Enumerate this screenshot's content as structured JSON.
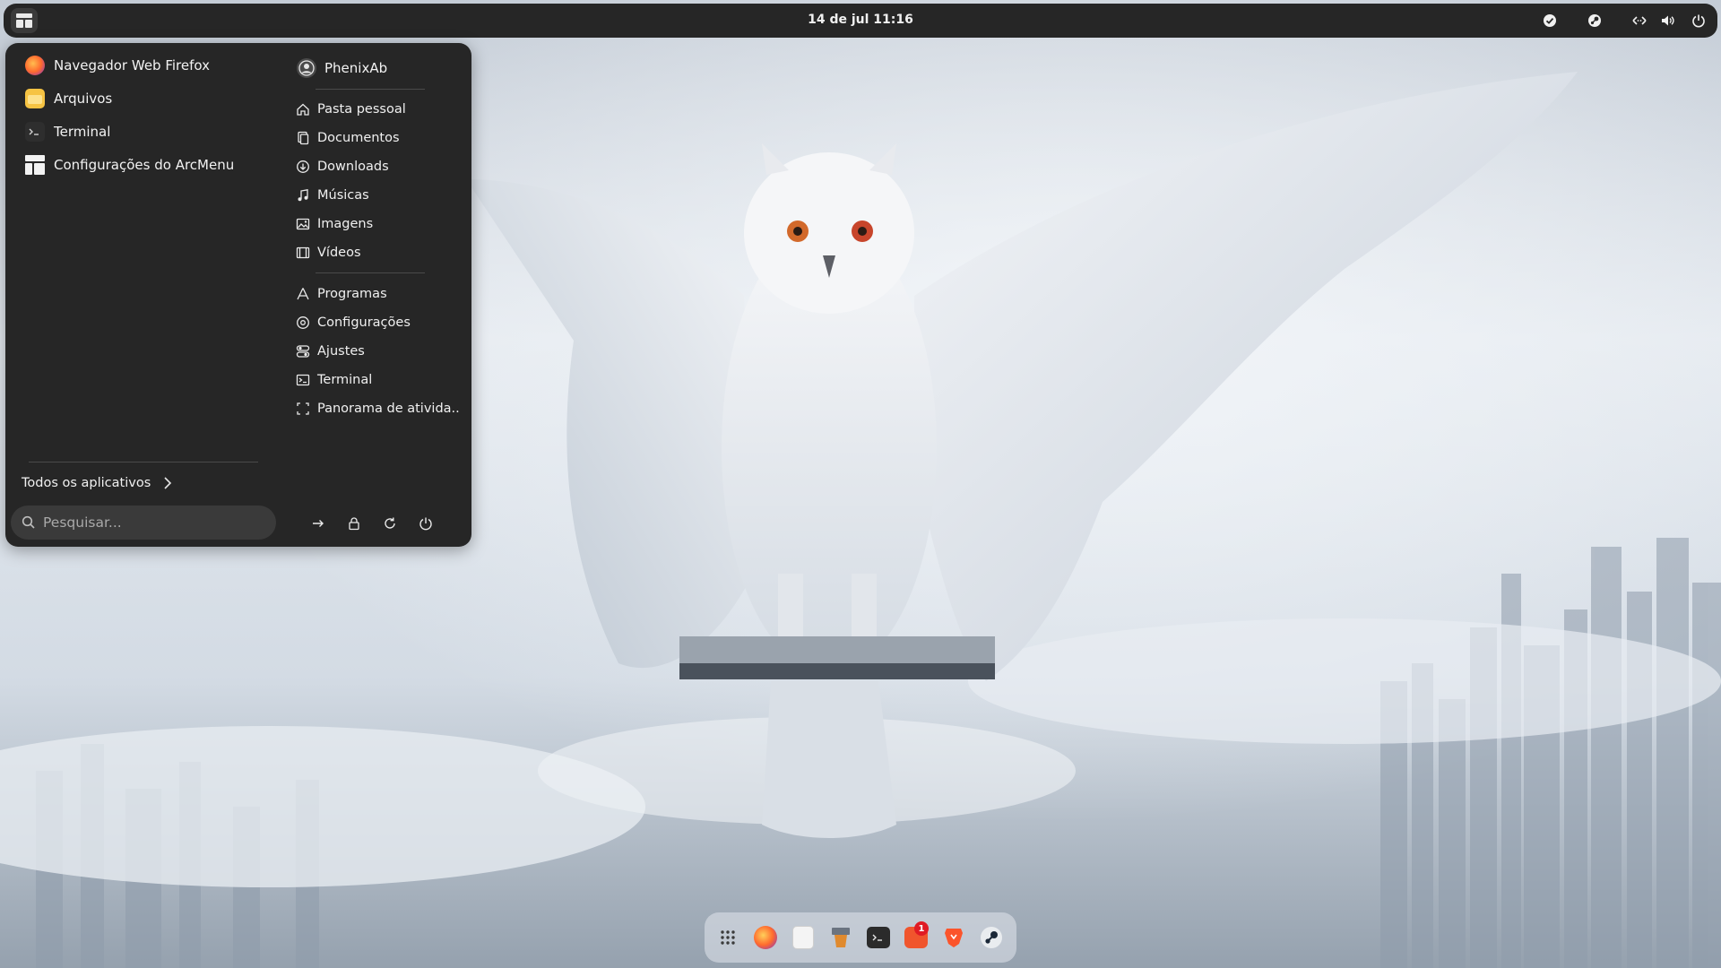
{
  "topbar": {
    "clock": "14 de jul  11:16"
  },
  "menu": {
    "favorites": [
      {
        "label": "Navegador Web Firefox",
        "icon": "firefox-icon"
      },
      {
        "label": "Arquivos",
        "icon": "files-icon"
      },
      {
        "label": "Terminal",
        "icon": "terminal-icon"
      },
      {
        "label": "Configurações do ArcMenu",
        "icon": "arcmenu-settings-icon"
      }
    ],
    "user": {
      "name": "PhenixAb",
      "icon": "user-avatar-icon"
    },
    "places": [
      {
        "label": "Pasta pessoal",
        "icon": "home-icon"
      },
      {
        "label": "Documentos",
        "icon": "documents-icon"
      },
      {
        "label": "Downloads",
        "icon": "downloads-icon"
      },
      {
        "label": "Músicas",
        "icon": "music-icon"
      },
      {
        "label": "Imagens",
        "icon": "images-icon"
      },
      {
        "label": "Vídeos",
        "icon": "videos-icon"
      }
    ],
    "system": [
      {
        "label": "Programas",
        "icon": "software-icon"
      },
      {
        "label": "Configurações",
        "icon": "settings-icon"
      },
      {
        "label": "Ajustes",
        "icon": "tweaks-icon"
      },
      {
        "label": "Terminal",
        "icon": "terminal-icon"
      },
      {
        "label": "Panorama de ativida...",
        "icon": "activities-overview-icon"
      }
    ],
    "all_apps_label": "Todos os aplicativos",
    "search_placeholder": "Pesquisar..."
  },
  "dock": {
    "items": [
      "app-grid-icon",
      "firefox-icon",
      "text-editor-icon",
      "software-store-icon",
      "terminal-icon",
      "software-updates-icon",
      "brave-icon",
      "steam-icon"
    ],
    "badge": "1"
  },
  "colors": {
    "panel": "#262626",
    "dock": "#e1e6ec",
    "badge": "#e01b24"
  }
}
